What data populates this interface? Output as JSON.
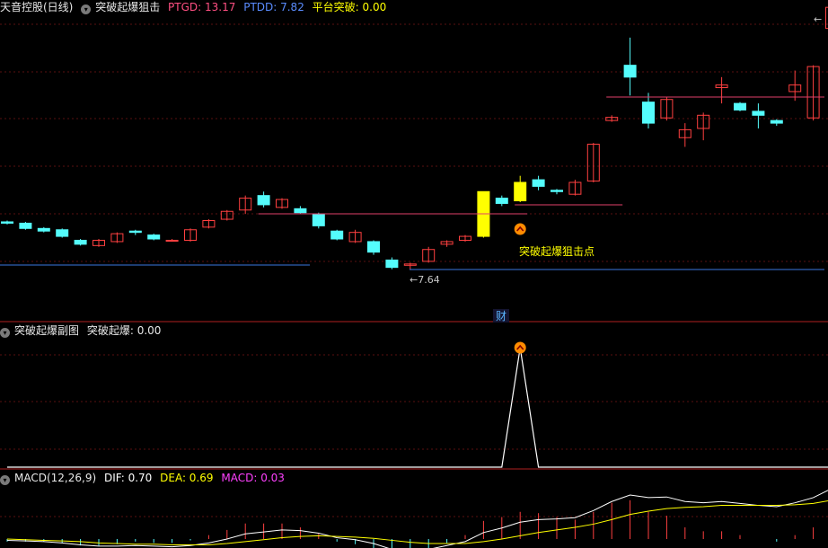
{
  "main_header": {
    "stock_name": "天音控股(日线)",
    "indicator_name": "突破起爆狙击",
    "ptgd_label": "PTGD: 13.17",
    "ptdd_label": "PTDD: 7.82",
    "breakout_label": "平台突破: 0.00"
  },
  "sub_header": {
    "indicator_name": "突破起爆副图",
    "value_label": "突破起爆: 0.00"
  },
  "macd_header": {
    "name": "MACD(12,26,9)",
    "dif_label": "DIF: 0.70",
    "dea_label": "DEA: 0.69",
    "macd_label": "MACD: 0.03"
  },
  "annotations": {
    "signal_text": "突破起爆狙击点",
    "low_marker": "←7.64",
    "high_marker": "←",
    "finance_badge": "财"
  },
  "colors": {
    "up": "#ff4040",
    "down": "#54fcfc",
    "signal": "#ffff00",
    "platform_high": "#e0406a",
    "platform_low": "#3a78e0",
    "dif": "#ffffff",
    "dea": "#ffff00",
    "macd": "#ff40ff"
  },
  "chart_data": [
    {
      "type": "candlestick",
      "title": "天音控股(日线)",
      "series": [
        {
          "name": "K",
          "ohlc": [
            [
              9.45,
              9.5,
              9.35,
              9.4
            ],
            [
              9.4,
              9.45,
              9.15,
              9.2
            ],
            [
              9.2,
              9.25,
              9.05,
              9.1
            ],
            [
              9.15,
              9.2,
              8.85,
              8.9
            ],
            [
              8.75,
              8.8,
              8.55,
              8.6
            ],
            [
              8.55,
              8.8,
              8.5,
              8.75
            ],
            [
              8.7,
              9.05,
              8.65,
              9.0
            ],
            [
              9.1,
              9.15,
              8.95,
              9.05
            ],
            [
              8.95,
              9.0,
              8.75,
              8.8
            ],
            [
              8.75,
              8.8,
              8.7,
              8.75
            ],
            [
              8.75,
              9.2,
              8.7,
              9.15
            ],
            [
              9.25,
              9.55,
              9.2,
              9.5
            ],
            [
              9.55,
              9.9,
              9.5,
              9.85
            ],
            [
              9.9,
              10.45,
              9.75,
              10.35
            ],
            [
              10.45,
              10.6,
              10.0,
              10.1
            ],
            [
              10.0,
              10.35,
              9.95,
              10.3
            ],
            [
              9.95,
              10.05,
              9.75,
              9.8
            ],
            [
              9.75,
              9.8,
              9.2,
              9.3
            ],
            [
              9.1,
              9.15,
              8.75,
              8.8
            ],
            [
              8.7,
              9.15,
              8.65,
              9.05
            ],
            [
              8.7,
              8.75,
              8.2,
              8.3
            ],
            [
              8.0,
              8.1,
              7.65,
              7.72
            ],
            [
              7.8,
              7.9,
              7.64,
              7.85
            ],
            [
              7.95,
              8.5,
              7.9,
              8.4
            ],
            [
              8.6,
              8.75,
              8.5,
              8.7
            ],
            [
              8.75,
              8.95,
              8.7,
              8.9
            ],
            [
              8.9,
              10.6,
              8.85,
              10.6
            ],
            [
              10.35,
              10.45,
              10.05,
              10.15
            ],
            [
              10.25,
              11.2,
              10.2,
              10.95
            ],
            [
              11.05,
              11.2,
              10.65,
              10.8
            ],
            [
              10.65,
              10.7,
              10.5,
              10.6
            ],
            [
              10.5,
              11.05,
              10.45,
              10.95
            ],
            [
              11.0,
              12.45,
              10.95,
              12.4
            ],
            [
              13.3,
              13.5,
              13.25,
              13.42
            ],
            [
              15.4,
              16.45,
              14.25,
              14.95
            ],
            [
              14.0,
              14.35,
              13.0,
              13.2
            ],
            [
              13.4,
              14.2,
              13.3,
              14.1
            ],
            [
              12.65,
              13.2,
              12.3,
              12.95
            ],
            [
              13.0,
              13.6,
              12.55,
              13.5
            ],
            [
              14.55,
              14.95,
              13.95,
              14.65
            ],
            [
              13.95,
              14.0,
              13.65,
              13.7
            ],
            [
              13.65,
              13.95,
              13.0,
              13.5
            ],
            [
              13.3,
              13.35,
              13.1,
              13.2
            ],
            [
              14.4,
              15.2,
              14.05,
              14.65
            ],
            [
              13.4,
              15.4,
              13.3,
              15.35
            ],
            [
              16.8,
              18.05,
              16.4,
              17.6
            ],
            [
              17.2,
              17.25,
              16.35,
              16.4
            ]
          ]
        }
      ],
      "platform_high": 13.17,
      "platform_low": 7.82,
      "signal_bars": [
        26,
        28
      ],
      "low_marker_value": 7.64
    },
    {
      "type": "line",
      "title": "突破起爆副图",
      "series": [
        {
          "name": "突破起爆",
          "values": [
            0,
            0,
            0,
            0,
            0,
            0,
            0,
            0,
            0,
            0,
            0,
            0,
            0,
            0,
            0,
            0,
            0,
            0,
            0,
            0,
            0,
            0,
            0,
            0,
            0,
            0,
            0,
            0,
            1,
            0,
            0,
            0,
            0,
            0,
            0,
            0,
            0,
            0,
            0,
            0,
            0,
            0,
            0,
            0,
            0,
            0,
            0
          ]
        }
      ]
    },
    {
      "type": "line",
      "title": "MACD(12,26,9)",
      "series": [
        {
          "name": "DIF",
          "values": [
            -0.02,
            -0.03,
            -0.04,
            -0.06,
            -0.09,
            -0.11,
            -0.11,
            -0.1,
            -0.11,
            -0.12,
            -0.1,
            -0.06,
            0.0,
            0.08,
            0.11,
            0.14,
            0.13,
            0.09,
            0.02,
            -0.01,
            -0.07,
            -0.16,
            -0.19,
            -0.16,
            -0.1,
            -0.04,
            0.1,
            0.17,
            0.26,
            0.3,
            0.31,
            0.33,
            0.44,
            0.58,
            0.68,
            0.64,
            0.65,
            0.58,
            0.56,
            0.58,
            0.55,
            0.52,
            0.5,
            0.56,
            0.64,
            0.78,
            0.7
          ]
        },
        {
          "name": "DEA",
          "values": [
            0.0,
            -0.01,
            -0.02,
            -0.03,
            -0.04,
            -0.06,
            -0.07,
            -0.08,
            -0.08,
            -0.09,
            -0.09,
            -0.09,
            -0.07,
            -0.04,
            -0.01,
            0.02,
            0.04,
            0.05,
            0.04,
            0.03,
            0.01,
            -0.02,
            -0.05,
            -0.07,
            -0.07,
            -0.07,
            -0.04,
            -0.0,
            0.05,
            0.1,
            0.14,
            0.18,
            0.23,
            0.3,
            0.38,
            0.43,
            0.47,
            0.49,
            0.5,
            0.52,
            0.52,
            0.52,
            0.52,
            0.53,
            0.55,
            0.6,
            0.69
          ]
        },
        {
          "name": "MACD",
          "values": [
            -0.04,
            -0.04,
            -0.04,
            -0.06,
            -0.1,
            -0.1,
            -0.08,
            -0.04,
            -0.06,
            -0.06,
            -0.02,
            0.06,
            0.14,
            0.24,
            0.24,
            0.24,
            0.18,
            0.08,
            -0.04,
            -0.08,
            -0.16,
            -0.28,
            -0.28,
            -0.18,
            -0.06,
            0.06,
            0.28,
            0.34,
            0.42,
            0.4,
            0.34,
            0.3,
            0.42,
            0.56,
            0.6,
            0.42,
            0.36,
            0.18,
            0.12,
            0.12,
            0.06,
            0.0,
            -0.04,
            0.06,
            0.18,
            0.36,
            0.03
          ]
        }
      ]
    }
  ]
}
